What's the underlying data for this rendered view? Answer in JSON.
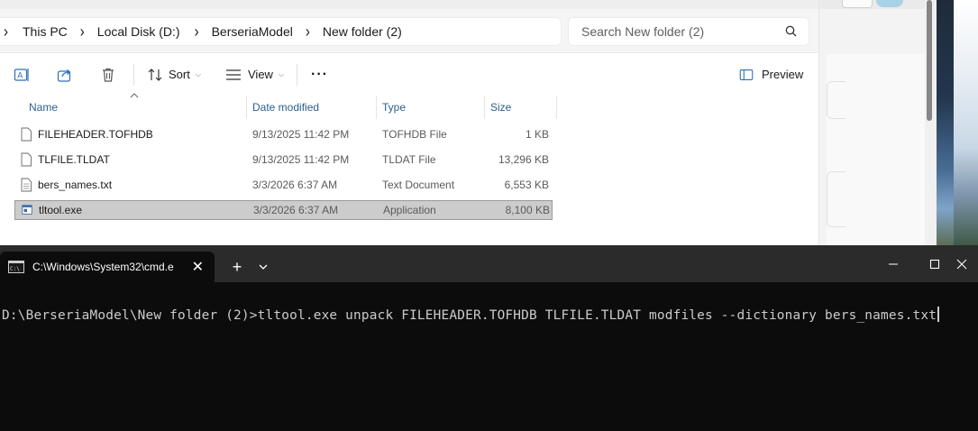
{
  "explorer": {
    "breadcrumb": [
      "This PC",
      "Local Disk (D:)",
      "BerseriaModel",
      "New folder (2)"
    ],
    "search_placeholder": "Search New folder (2)",
    "toolbar": {
      "sort_label": "Sort",
      "view_label": "View",
      "more_label": "···",
      "preview_label": "Preview"
    },
    "columns": {
      "name": "Name",
      "date": "Date modified",
      "type": "Type",
      "size": "Size"
    },
    "files": [
      {
        "name": "FILEHEADER.TOFHDB",
        "date": "9/13/2025 11:42 PM",
        "type": "TOFHDB File",
        "size": "1 KB",
        "icon": "file-icon"
      },
      {
        "name": "TLFILE.TLDAT",
        "date": "9/13/2025 11:42 PM",
        "type": "TLDAT File",
        "size": "13,296 KB",
        "icon": "file-icon"
      },
      {
        "name": "bers_names.txt",
        "date": "3/3/2026 6:37 AM",
        "type": "Text Document",
        "size": "6,553 KB",
        "icon": "text-file-icon"
      },
      {
        "name": "tltool.exe",
        "date": "3/3/2026 6:37 AM",
        "type": "Application",
        "size": "8,100 KB",
        "icon": "application-icon",
        "selected": true
      }
    ]
  },
  "terminal": {
    "tab_title": "C:\\Windows\\System32\\cmd.e",
    "new_tab": "+",
    "prompt": "D:\\BerseriaModel\\New folder (2)>",
    "command": "tltool.exe unpack FILEHEADER.TOFHDB TLFILE.TLDAT modfiles --dictionary bers_names.txt"
  },
  "colors": {
    "terminal_bg": "#0c0c0c",
    "terminal_text": "#cccccc",
    "header_text": "#2b5f8d",
    "selection": "#cccccc"
  }
}
